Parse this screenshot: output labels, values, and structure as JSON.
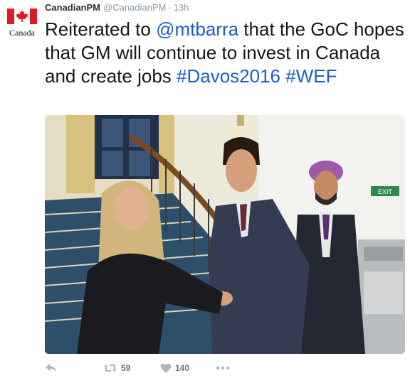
{
  "account": {
    "name": "CanadianPM",
    "handle": "@CanadianPM",
    "separator": "·",
    "time": "13h",
    "avatar_wordmark": "Canada",
    "avatar_icon": "canada-flag-icon"
  },
  "tweet": {
    "text_before": "Reiterated to ",
    "mention": "@mtbarra",
    "text_middle": " that the GoC hopes that GM will continue to invest in Canada and create jobs ",
    "hashtag1": "#Davos2016",
    "hashtag2": "#WEF",
    "link_color": "#1b5fc4"
  },
  "photo": {
    "exit_sign": "EXIT"
  },
  "actions": {
    "reply_icon": "reply-icon",
    "retweet_icon": "retweet-icon",
    "retweet_count": "59",
    "like_icon": "heart-icon",
    "like_count": "140",
    "more_icon": "more-icon"
  }
}
